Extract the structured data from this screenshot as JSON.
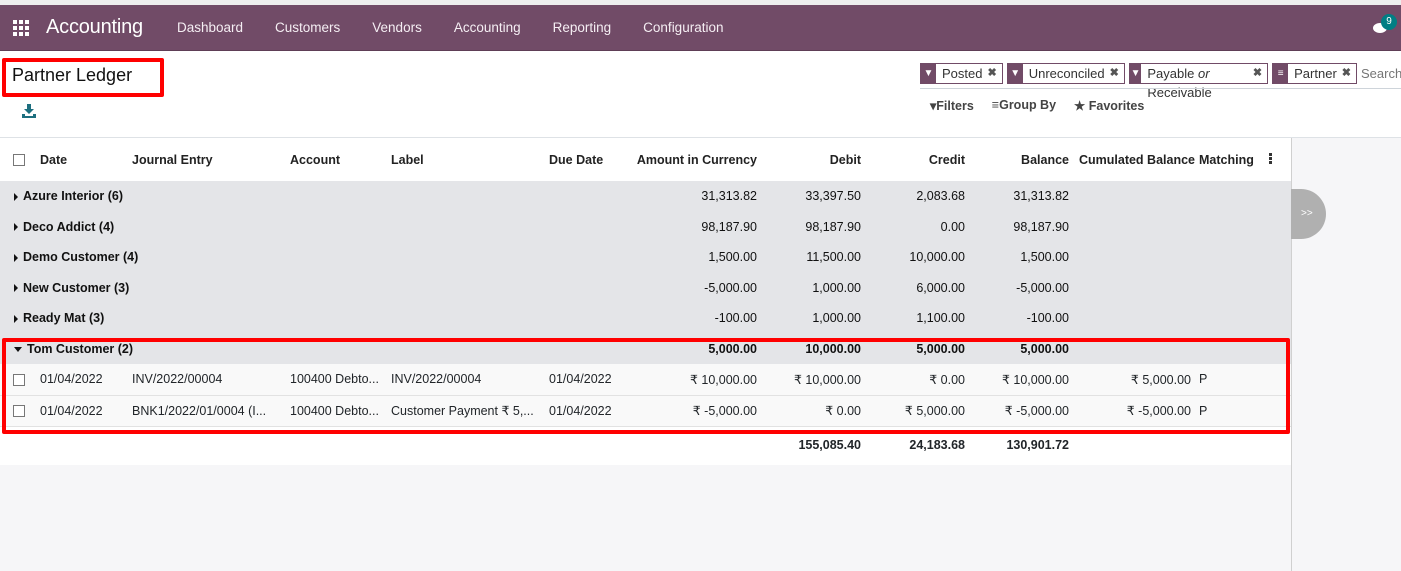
{
  "navbar": {
    "app_title": "Accounting",
    "menu": [
      "Dashboard",
      "Customers",
      "Vendors",
      "Accounting",
      "Reporting",
      "Configuration"
    ],
    "chat_badge_count": "9",
    "bg_color": "#714b67"
  },
  "control": {
    "page_title": "Partner Ledger",
    "download_icon": "download-icon",
    "facets": [
      {
        "icon": "filter-icon",
        "label": "Posted"
      },
      {
        "icon": "filter-icon",
        "label": "Unreconciled"
      },
      {
        "icon": "filter-icon",
        "label_parts": [
          "Payable",
          "or",
          "Receivable"
        ]
      },
      {
        "icon": "group-by-icon",
        "label": "Partner"
      }
    ],
    "search_placeholder": "Search...",
    "search_buttons": {
      "filters": "Filters",
      "group_by": "Group By",
      "favorites": "Favorites"
    }
  },
  "table": {
    "columns": [
      "Date",
      "Journal Entry",
      "Account",
      "Label",
      "Due Date",
      "Amount in Currency",
      "Debit",
      "Credit",
      "Balance",
      "Cumulated Balance",
      "Matching"
    ],
    "groups": [
      {
        "name": "Azure Interior (6)",
        "amount_currency": "31,313.82",
        "debit": "33,397.50",
        "credit": "2,083.68",
        "balance": "31,313.82",
        "expanded": false
      },
      {
        "name": "Deco Addict (4)",
        "amount_currency": "98,187.90",
        "debit": "98,187.90",
        "credit": "0.00",
        "balance": "98,187.90",
        "expanded": false
      },
      {
        "name": "Demo Customer (4)",
        "amount_currency": "1,500.00",
        "debit": "11,500.00",
        "credit": "10,000.00",
        "balance": "1,500.00",
        "expanded": false
      },
      {
        "name": "New Customer (3)",
        "amount_currency": "-5,000.00",
        "debit": "1,000.00",
        "credit": "6,000.00",
        "balance": "-5,000.00",
        "expanded": false
      },
      {
        "name": "Ready Mat (3)",
        "amount_currency": "-100.00",
        "debit": "1,000.00",
        "credit": "1,100.00",
        "balance": "-100.00",
        "expanded": false
      },
      {
        "name": "Tom Customer (2)",
        "amount_currency": "5,000.00",
        "debit": "10,000.00",
        "credit": "5,000.00",
        "balance": "5,000.00",
        "expanded": true
      }
    ],
    "records": [
      {
        "date": "01/04/2022",
        "journal_entry": "INV/2022/00004",
        "account": "100400 Debto...",
        "label": "INV/2022/00004",
        "due_date": "01/04/2022",
        "amount_currency": "₹ 10,000.00",
        "debit": "₹ 10,000.00",
        "credit": "₹ 0.00",
        "balance": "₹ 10,000.00",
        "cumulated_balance": "₹ 5,000.00",
        "matching": "P"
      },
      {
        "date": "01/04/2022",
        "journal_entry": "BNK1/2022/01/0004 (I...",
        "account": "100400 Debto...",
        "label": "Customer Payment ₹ 5,...",
        "due_date": "01/04/2022",
        "amount_currency": "₹ -5,000.00",
        "debit": "₹ 0.00",
        "credit": "₹ 5,000.00",
        "balance": "₹ -5,000.00",
        "cumulated_balance": "₹ -5,000.00",
        "matching": "P"
      }
    ],
    "totals": {
      "debit": "155,085.40",
      "credit": "24,183.68",
      "balance": "130,901.72"
    }
  },
  "side_panel": {
    "toggle_label": ">>"
  },
  "highlight_color": "#ff0000"
}
